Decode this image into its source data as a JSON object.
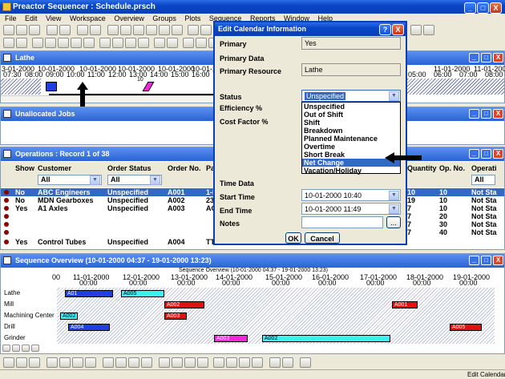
{
  "app": {
    "title": "Preactor Sequencer : Schedule.prsch"
  },
  "menu": [
    "File",
    "Edit",
    "View",
    "Workspace",
    "Overview",
    "Groups",
    "Plots",
    "Sequence",
    "Reports",
    "Window",
    "Help"
  ],
  "lathe_panel": {
    "title": "Lathe",
    "dates": [
      "3-01-2000",
      "10-01-2000",
      "10-01-2000",
      "10-01-2000",
      "10-01-2000",
      "10-01-2000",
      "10-01-2000"
    ],
    "times": [
      "07:30",
      "08:00",
      "09:00",
      "10:00",
      "11:00",
      "12:00",
      "13:00",
      "14:00",
      "15:00",
      "16:00",
      "17:00"
    ],
    "right_dates": [
      "11-01-2000",
      "11-01-2000"
    ],
    "right_times": [
      "05:00",
      "06:00",
      "07:00",
      "08:00"
    ],
    "marker": "10"
  },
  "unallocated_panel": {
    "title": "Unallocated Jobs"
  },
  "operations_panel": {
    "title": "Operations : Record 1 of 38",
    "columns": [
      "Show",
      "Customer",
      "Order Status",
      "Order No.",
      "Pa"
    ],
    "right_columns": [
      "Quantity",
      "Op. No.",
      "Operati"
    ],
    "filter_all": "All",
    "rows": [
      {
        "show": "No",
        "customer": "ABC Engineers",
        "status": "Unspecified",
        "order": "A001",
        "pa": "1-I",
        "qty": "10",
        "op": "10",
        "opstatus": "Not Sta"
      },
      {
        "show": "No",
        "customer": "MDN Gearboxes",
        "status": "Unspecified",
        "order": "A002",
        "pa": "237",
        "qty": "19",
        "op": "10",
        "opstatus": "Not Sta"
      },
      {
        "show": "Yes",
        "customer": "A1 Axles",
        "status": "Unspecified",
        "order": "A003",
        "pa": "AC",
        "qty": "7",
        "op": "10",
        "opstatus": "Not Sta"
      },
      {
        "show": "",
        "customer": "",
        "status": "",
        "order": "",
        "pa": "",
        "qty": "7",
        "op": "20",
        "opstatus": "Not Sta"
      },
      {
        "show": "",
        "customer": "",
        "status": "",
        "order": "",
        "pa": "",
        "qty": "7",
        "op": "30",
        "opstatus": "Not Sta"
      },
      {
        "show": "",
        "customer": "",
        "status": "",
        "order": "",
        "pa": "",
        "qty": "7",
        "op": "40",
        "opstatus": "Not Sta"
      },
      {
        "show": "Yes",
        "customer": "Control Tubes",
        "status": "Unspecified",
        "order": "A004",
        "pa": "TT",
        "qty": "",
        "op": "",
        "opstatus": ""
      }
    ]
  },
  "sequence_panel": {
    "title": "Sequence Overview   (10-01-2000 04:37 - 19-01-2000 13:23)",
    "subtitle": "Sequence Overview   (10-01-2000 04:37 - 19-01-2000 13:23)",
    "dates": [
      "11-01-2000",
      "12-01-2000",
      "13-01-2000",
      "14-01-2000",
      "15-01-2000",
      "16-01-2000",
      "17-01-2000",
      "18-01-2000",
      "19-01-2000"
    ],
    "time": "00:00",
    "resources": [
      "Lathe",
      "Mill",
      "Machining Center",
      "Drill",
      "Grinder"
    ],
    "bars": [
      "A01",
      "A005",
      "A002",
      "A001",
      "A002",
      "A003",
      "A004",
      "A005",
      "A003",
      "A002"
    ],
    "left_mark": "00"
  },
  "dialog": {
    "title": "Edit Calendar Information",
    "fields": {
      "primary_label": "Primary",
      "primary_value": "Yes",
      "primary_data_label": "Primary Data",
      "primary_resource_label": "Primary Resource",
      "primary_resource_value": "Lathe",
      "status_label": "Status",
      "status_value": "Unspecified",
      "efficiency_label": "Efficiency %",
      "cost_factor_label": "Cost Factor %",
      "time_data_label": "Time Data",
      "start_time_label": "Start Time",
      "start_time_value": "10-01-2000 10:40",
      "end_time_label": "End Time",
      "end_time_value": "10-01-2000 11:49",
      "notes_label": "Notes",
      "notes_btn": "..."
    },
    "dropdown_options": [
      "Unspecified",
      "Out of Shift",
      "Shift",
      "Breakdown",
      "Planned Maintenance",
      "Overtime",
      "Short Break",
      "Net Change",
      "Vacation/Holiday"
    ],
    "selected_option": "Net Change",
    "ok": "OK",
    "cancel": "Cancel",
    "help": "?",
    "close": "X"
  },
  "statusbar": {
    "text": "Edit Calendar"
  },
  "colors": {
    "accent": "#0a46c9",
    "selection": "#316ac5",
    "bar_blue": "#1f3fe0",
    "bar_cyan": "#3ef0f0",
    "bar_red": "#e01010",
    "bar_magenta": "#ee2ad6"
  }
}
